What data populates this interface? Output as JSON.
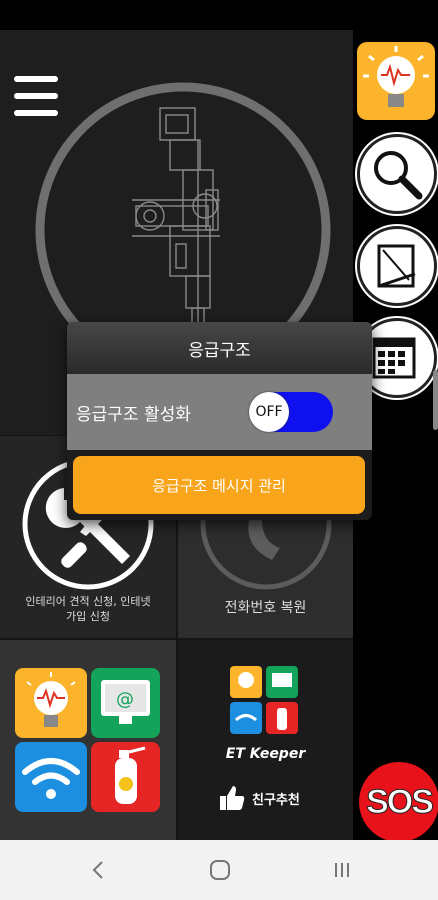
{
  "menu": {
    "icon": "hamburger-menu-icon"
  },
  "tiles": {
    "interior": {
      "label_line1": "인테리어 견적 신청, 인테넷",
      "label_line2": "가입 신청"
    },
    "phone_restore": {
      "label": "전화번호 복원"
    },
    "et_keeper": {
      "label": "ET Keeper",
      "recommend": "친구추천"
    }
  },
  "rightbar": {
    "items": [
      "lightbulb-icon",
      "magnifier-icon",
      "note-pad-icon",
      "calendar-icon"
    ],
    "sos": "SOS"
  },
  "dialog": {
    "title": "응급구조",
    "activate_label": "응급구조 활성화",
    "toggle_state": "OFF",
    "manage_button": "응급구조 메시지 관리"
  },
  "navbar": {
    "back": "‹",
    "home": "○",
    "recents": "|||"
  },
  "colors": {
    "accent_orange": "#f9a51b",
    "toggle_blue": "#0e10f0",
    "sos_red": "#e8121b"
  }
}
